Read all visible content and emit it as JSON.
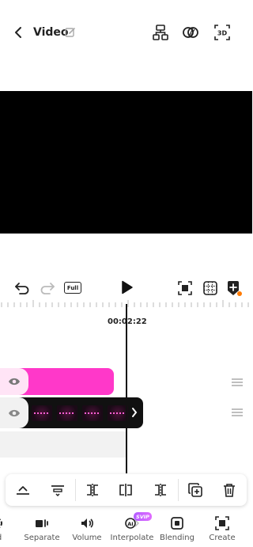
{
  "header": {
    "title": "Video"
  },
  "controls": {
    "full_label": "Full",
    "timecode": "00:02:22"
  },
  "bottom_nav": {
    "badge": "SVIP",
    "items": [
      {
        "label": "ed",
        "icon": "partial-icon"
      },
      {
        "label": "Separate",
        "icon": "separate-audio-icon"
      },
      {
        "label": "Volume",
        "icon": "volume-icon"
      },
      {
        "label": "Interpolate",
        "icon": "ai-interpolate-icon"
      },
      {
        "label": "Blending",
        "icon": "blending-icon"
      },
      {
        "label": "Create",
        "icon": "create-icon"
      }
    ]
  },
  "colors": {
    "accent_pink": "#ff38c9",
    "svip_purple": "#b35cff",
    "dot_orange": "#ff7a00"
  }
}
